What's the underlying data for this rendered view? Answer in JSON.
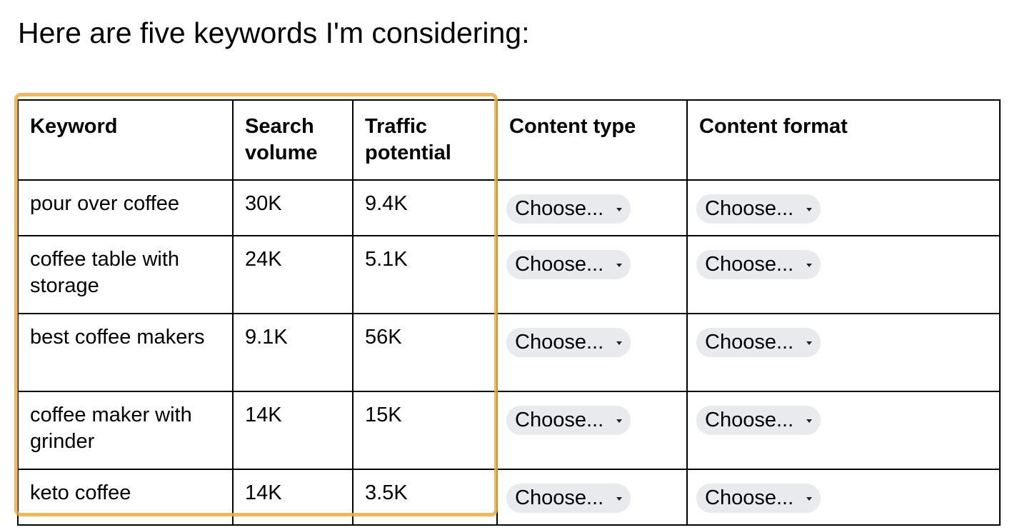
{
  "intro_text": "Here are five keywords I'm considering:",
  "table": {
    "headers": [
      "Keyword",
      "Search volume",
      "Traffic potential",
      "Content type",
      "Content format"
    ],
    "rows": [
      {
        "keyword": "pour over coffee",
        "search_volume": "30K",
        "traffic_potential": "9.4K",
        "content_type": "Choose...",
        "content_format": "Choose..."
      },
      {
        "keyword": "coffee table with storage",
        "search_volume": "24K",
        "traffic_potential": "5.1K",
        "content_type": "Choose...",
        "content_format": "Choose..."
      },
      {
        "keyword": "best coffee makers",
        "search_volume": "9.1K",
        "traffic_potential": "56K",
        "content_type": "Choose...",
        "content_format": "Choose..."
      },
      {
        "keyword": "coffee maker with grinder",
        "search_volume": "14K",
        "traffic_potential": "15K",
        "content_type": "Choose...",
        "content_format": "Choose..."
      },
      {
        "keyword": "keto coffee",
        "search_volume": "14K",
        "traffic_potential": "3.5K",
        "content_type": "Choose...",
        "content_format": "Choose..."
      }
    ]
  },
  "highlight": {
    "covers_columns": [
      "Keyword",
      "Search volume",
      "Traffic potential"
    ],
    "color": "#EEAA3C"
  },
  "chip_background": "#E9EAEE"
}
